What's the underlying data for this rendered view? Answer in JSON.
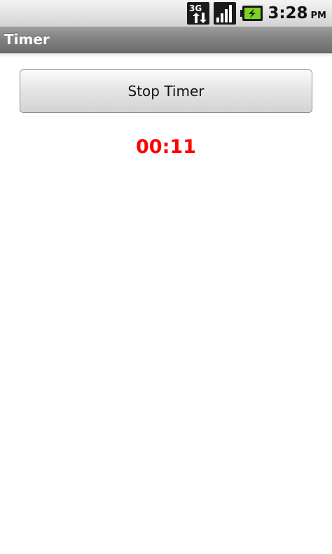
{
  "status_bar": {
    "network_type": "3G",
    "time": "3:28",
    "ampm": "PM",
    "icons": [
      "3g-data-icon",
      "signal-strength-icon",
      "battery-charging-icon"
    ]
  },
  "app": {
    "title": "Timer"
  },
  "main": {
    "stop_button_label": "Stop Timer",
    "timer_value": "00:11",
    "timer_color": "#ff0000"
  }
}
